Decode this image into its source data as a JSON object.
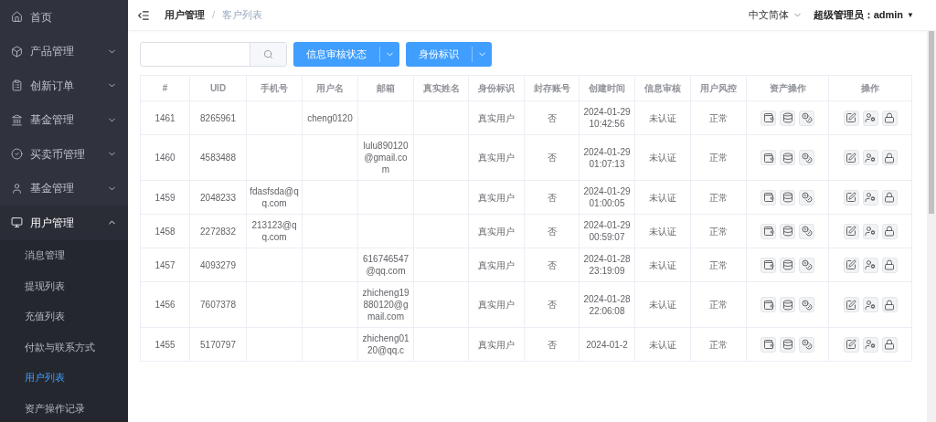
{
  "sidebar": {
    "items": [
      {
        "label": "首页"
      },
      {
        "label": "产品管理",
        "expanded": false
      },
      {
        "label": "创新订单",
        "expanded": false
      },
      {
        "label": "基金管理",
        "expanded": false
      },
      {
        "label": "买卖币管理",
        "expanded": false
      },
      {
        "label": "基金管理",
        "expanded": false
      },
      {
        "label": "用户管理",
        "expanded": true,
        "children": [
          {
            "label": "消息管理",
            "selected": false
          },
          {
            "label": "提现列表",
            "selected": false
          },
          {
            "label": "充值列表",
            "selected": false
          },
          {
            "label": "付款与联系方式",
            "selected": false
          },
          {
            "label": "用户列表",
            "selected": true
          },
          {
            "label": "资产操作记录",
            "selected": false
          }
        ]
      }
    ]
  },
  "header": {
    "breadcrumb": [
      "用户管理",
      "客户列表"
    ],
    "separator": "/",
    "language": "中文简体",
    "user_label": "超级管理员：",
    "user_name": "admin",
    "user_caret": "▼"
  },
  "filters": {
    "dropdowns": [
      "信息审核状态",
      "身份标识"
    ]
  },
  "table": {
    "columns": [
      "#",
      "UID",
      "手机号",
      "用户名",
      "邮箱",
      "真实姓名",
      "身份标识",
      "封存账号",
      "创建时间",
      "信息审核",
      "用户风控",
      "资产操作",
      "操作"
    ],
    "rows": [
      {
        "id": "1461",
        "uid": "8265961",
        "phone": "",
        "username": "cheng0120",
        "email": "",
        "real_name": "",
        "identity": "真实用户",
        "archived": "否",
        "created": "2024-01-29 10:42:56",
        "review": "未认证",
        "risk": "正常"
      },
      {
        "id": "1460",
        "uid": "4583488",
        "phone": "",
        "username": "",
        "email": "lulu890120@gmail.com",
        "real_name": "",
        "identity": "真实用户",
        "archived": "否",
        "created": "2024-01-29 01:07:13",
        "review": "未认证",
        "risk": "正常"
      },
      {
        "id": "1459",
        "uid": "2048233",
        "phone": "fdasfsda@qq.com",
        "username": "",
        "email": "",
        "real_name": "",
        "identity": "真实用户",
        "archived": "否",
        "created": "2024-01-29 01:00:05",
        "review": "未认证",
        "risk": "正常"
      },
      {
        "id": "1458",
        "uid": "2272832",
        "phone": "213123@qq.com",
        "username": "",
        "email": "",
        "real_name": "",
        "identity": "真实用户",
        "archived": "否",
        "created": "2024-01-29 00:59:07",
        "review": "未认证",
        "risk": "正常"
      },
      {
        "id": "1457",
        "uid": "4093279",
        "phone": "",
        "username": "",
        "email": "616746547@qq.com",
        "real_name": "",
        "identity": "真实用户",
        "archived": "否",
        "created": "2024-01-28 23:19:09",
        "review": "未认证",
        "risk": "正常"
      },
      {
        "id": "1456",
        "uid": "7607378",
        "phone": "",
        "username": "",
        "email": "zhicheng19880120@gmail.com",
        "real_name": "",
        "identity": "真实用户",
        "archived": "否",
        "created": "2024-01-28 22:06:08",
        "review": "未认证",
        "risk": "正常"
      },
      {
        "id": "1455",
        "uid": "5170797",
        "phone": "",
        "username": "",
        "email": "zhicheng0120@qq.c",
        "real_name": "",
        "identity": "真实用户",
        "archived": "否",
        "created": "2024-01-2",
        "review": "未认证",
        "risk": "正常"
      }
    ]
  }
}
